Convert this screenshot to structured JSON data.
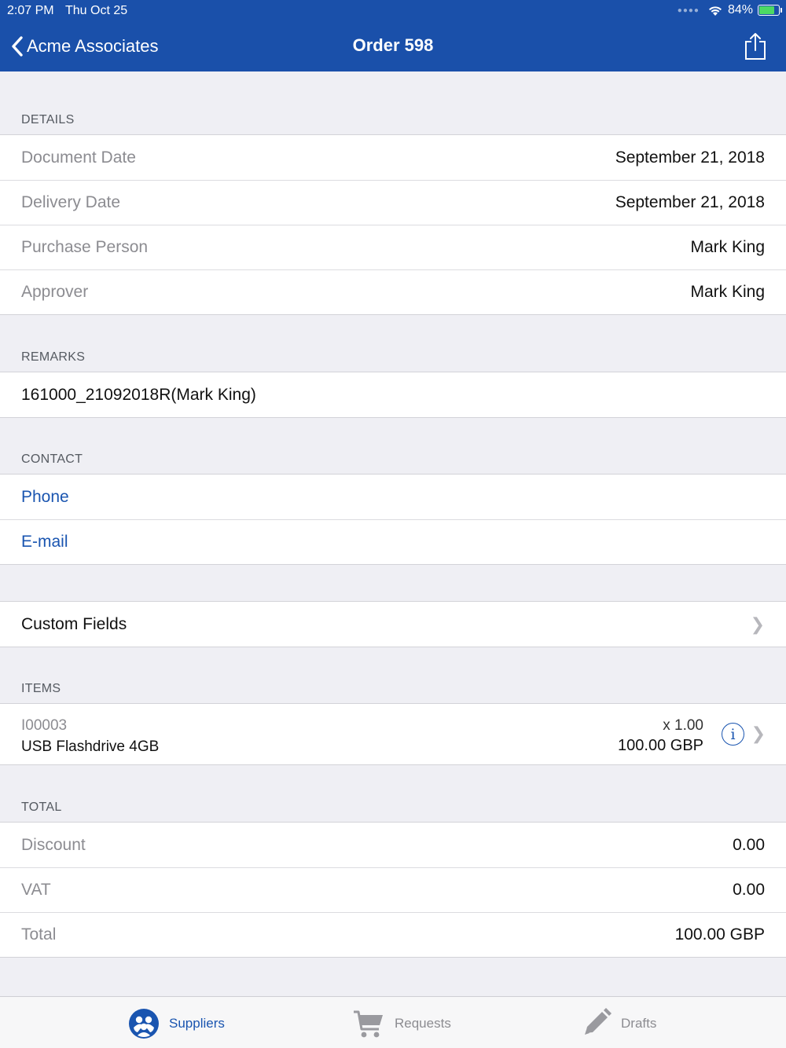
{
  "status_bar": {
    "time": "2:07 PM",
    "date": "Thu Oct 25",
    "battery": "84%",
    "battery_level": 0.84
  },
  "nav": {
    "back_label": "Acme Associates",
    "title": "Order 598",
    "share_icon": "share-icon"
  },
  "details": {
    "header": "DETAILS",
    "rows": [
      {
        "label": "Document Date",
        "value": "September 21, 2018"
      },
      {
        "label": "Delivery Date",
        "value": "September 21, 2018"
      },
      {
        "label": "Purchase Person",
        "value": "Mark King"
      },
      {
        "label": "Approver",
        "value": "Mark King"
      }
    ]
  },
  "remarks": {
    "header": "REMARKS",
    "text": "161000_21092018R(Mark King)"
  },
  "contact": {
    "header": "CONTACT",
    "phone": "Phone",
    "email": "E-mail"
  },
  "custom_fields": {
    "label": "Custom Fields"
  },
  "items": {
    "header": "ITEMS",
    "list": [
      {
        "code": "I00003",
        "name": "USB Flashdrive 4GB",
        "qty": "x 1.00",
        "price": "100.00 GBP"
      }
    ]
  },
  "total": {
    "header": "TOTAL",
    "rows": [
      {
        "label": "Discount",
        "value": "0.00"
      },
      {
        "label": "VAT",
        "value": "0.00"
      },
      {
        "label": "Total",
        "value": "100.00 GBP"
      }
    ]
  },
  "tabbar": {
    "tabs": [
      {
        "label": "Suppliers",
        "icon": "suppliers-icon",
        "active": true
      },
      {
        "label": "Requests",
        "icon": "cart-icon",
        "active": false
      },
      {
        "label": "Drafts",
        "icon": "pencil-icon",
        "active": false
      }
    ]
  },
  "colors": {
    "header_bg": "#1a50aa",
    "accent": "#1a55b0",
    "background": "#efeff4"
  }
}
